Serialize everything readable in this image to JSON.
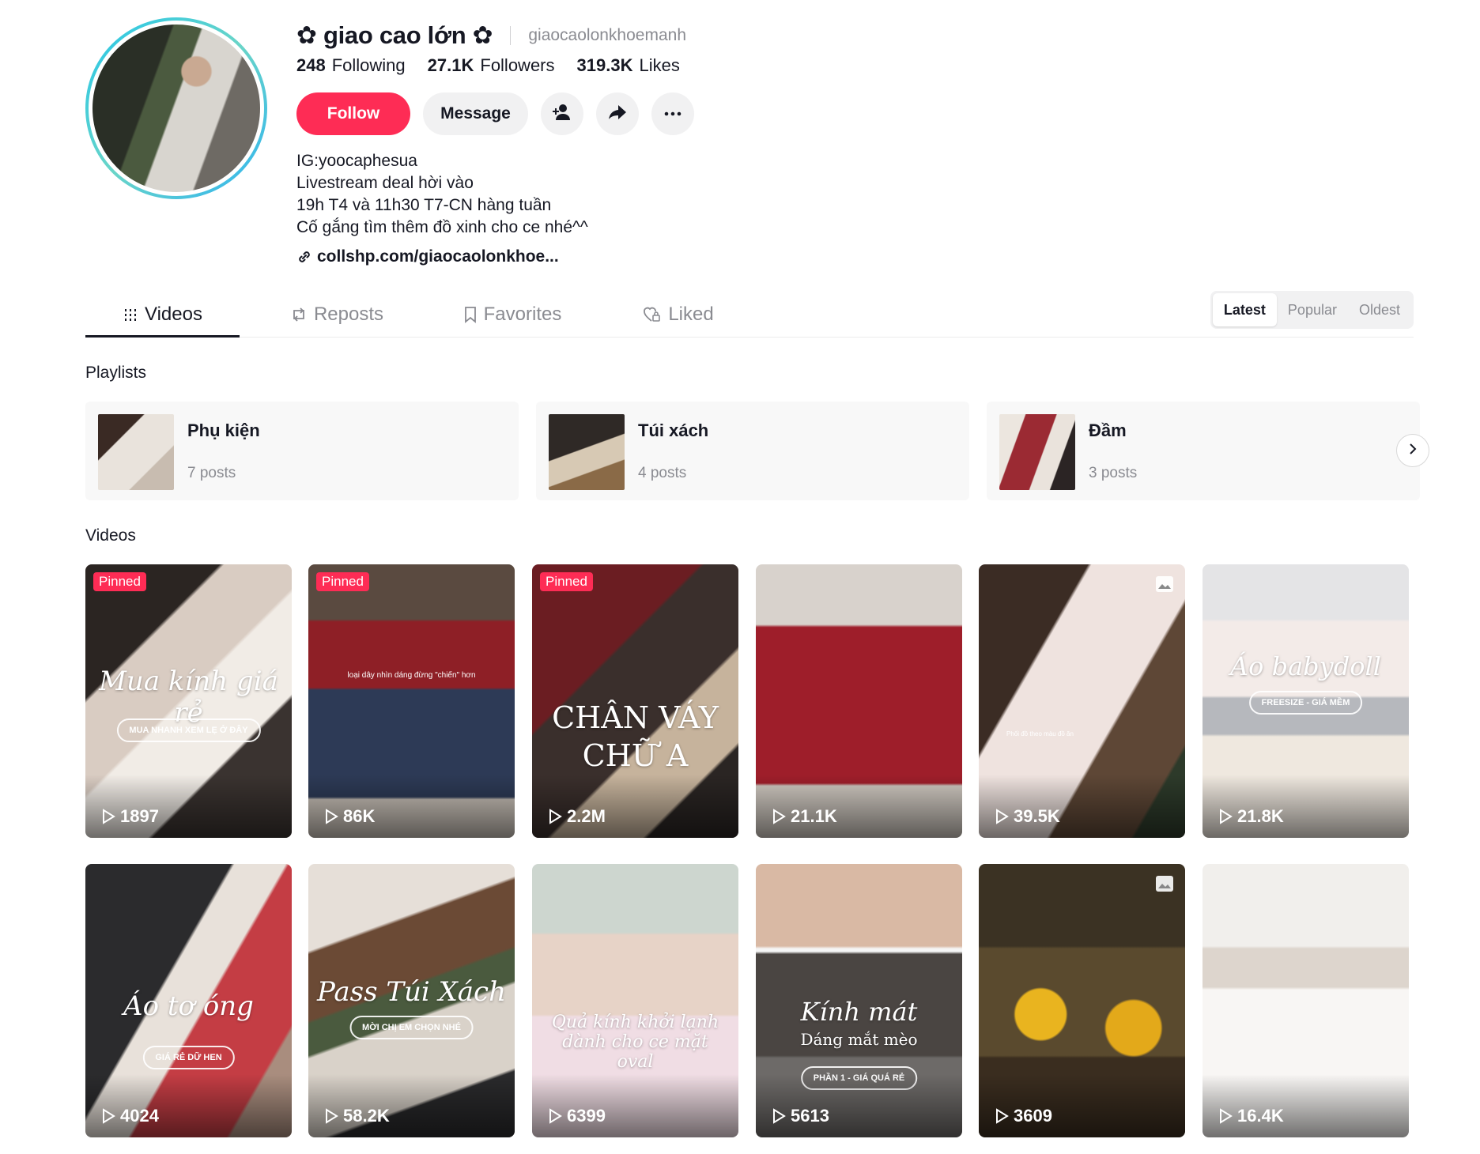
{
  "profile": {
    "nickname": "✿ giao cao lớn ✿",
    "username": "giaocaolonkhoemanh",
    "stats": [
      {
        "num": "248",
        "label": "Following"
      },
      {
        "num": "27.1K",
        "label": "Followers"
      },
      {
        "num": "319.3K",
        "label": "Likes"
      }
    ],
    "follow_label": "Follow",
    "message_label": "Message",
    "bio": [
      "IG:yoocaphesua",
      "Livestream deal hời vào",
      "19h T4 và 11h30 T7-CN hàng tuần",
      "Cố gắng tìm thêm đồ xinh cho ce nhé^^"
    ],
    "link": "collshp.com/giaocaolonkhoe..."
  },
  "tabs": [
    "Videos",
    "Reposts",
    "Favorites",
    "Liked"
  ],
  "sort": [
    "Latest",
    "Popular",
    "Oldest"
  ],
  "playlists_title": "Playlists",
  "playlists": [
    {
      "title": "Phụ kiện",
      "count": "7 posts"
    },
    {
      "title": "Túi xách",
      "count": "4 posts"
    },
    {
      "title": "Đầm",
      "count": "3 posts"
    }
  ],
  "videos_title": "Videos",
  "pinned_label": "Pinned",
  "videos": [
    {
      "views": "1897",
      "pinned": true,
      "overlay": "Mua kính giá rẻ",
      "pill": "MUA NHANH XEM LẸ Ở ĐÂY"
    },
    {
      "views": "86K",
      "pinned": true,
      "caption": "loại dây nhìn dáng đừng \"chiến\" hơn"
    },
    {
      "views": "2.2M",
      "pinned": true,
      "overlay": "CHÂN VÁY CHỮ A"
    },
    {
      "views": "21.1K"
    },
    {
      "views": "39.5K",
      "photo": true,
      "caption": "Phối đồ theo màu đồ ăn"
    },
    {
      "views": "21.8K",
      "overlay": "Áo babydoll",
      "pill": "FREESIZE - GIÁ MỀM"
    },
    {
      "views": "4024",
      "overlay": "Áo tơ óng",
      "pill": "GIÁ RẺ DỮ HEN"
    },
    {
      "views": "58.2K",
      "overlay": "Pass Túi Xách",
      "pill": "MỜI CHỊ EM CHỌN NHÉ"
    },
    {
      "views": "6399",
      "overlay": "Quả kính khởi lạnh dành cho ce mặt oval"
    },
    {
      "views": "5613",
      "overlay": "Kính mát",
      "subtitle": "Dáng mắt mèo",
      "pill": "PHẦN 1 - GIÁ QUÁ RẺ"
    },
    {
      "views": "3609",
      "photo": true
    },
    {
      "views": "16.4K"
    }
  ],
  "colors": {
    "accent": "#fe2c55",
    "text": "#161823",
    "muted": "#8a8b91",
    "chip_bg": "#f1f1f2"
  }
}
